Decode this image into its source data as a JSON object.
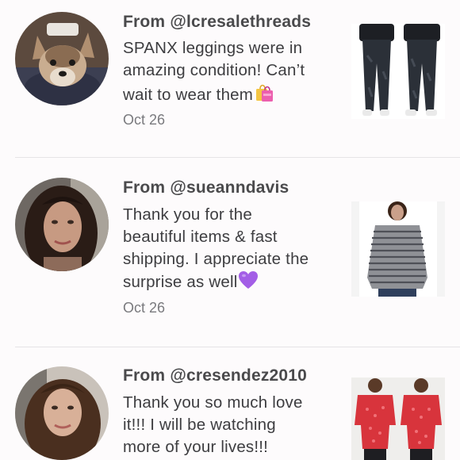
{
  "reviews": [
    {
      "from": "From @lcresalethreads",
      "lines": [
        "SPANX leggings were in",
        "amazing condition! Can’t",
        "wait to wear them"
      ],
      "emoji": "shopping-bags-icon",
      "date": "Oct 26"
    },
    {
      "from": "From @sueanndavis",
      "lines": [
        "Thank you for the",
        "beautiful items & fast",
        "shipping. I appreciate the",
        "surprise as well"
      ],
      "emoji": "purple-heart-icon",
      "date": "Oct 26"
    },
    {
      "from": "From @cresendez2010",
      "lines": [
        "Thank you so much love",
        "it!!! I will be watching",
        "more of your lives!!!"
      ],
      "emoji": "",
      "date": ""
    }
  ],
  "colors": {
    "background": "#fdfbfc",
    "text": "#3d3d40",
    "date": "#7a7a7e",
    "divider": "#e6e4e6",
    "purple_heart": "#a35ee6",
    "red_top": "#d8343c"
  }
}
